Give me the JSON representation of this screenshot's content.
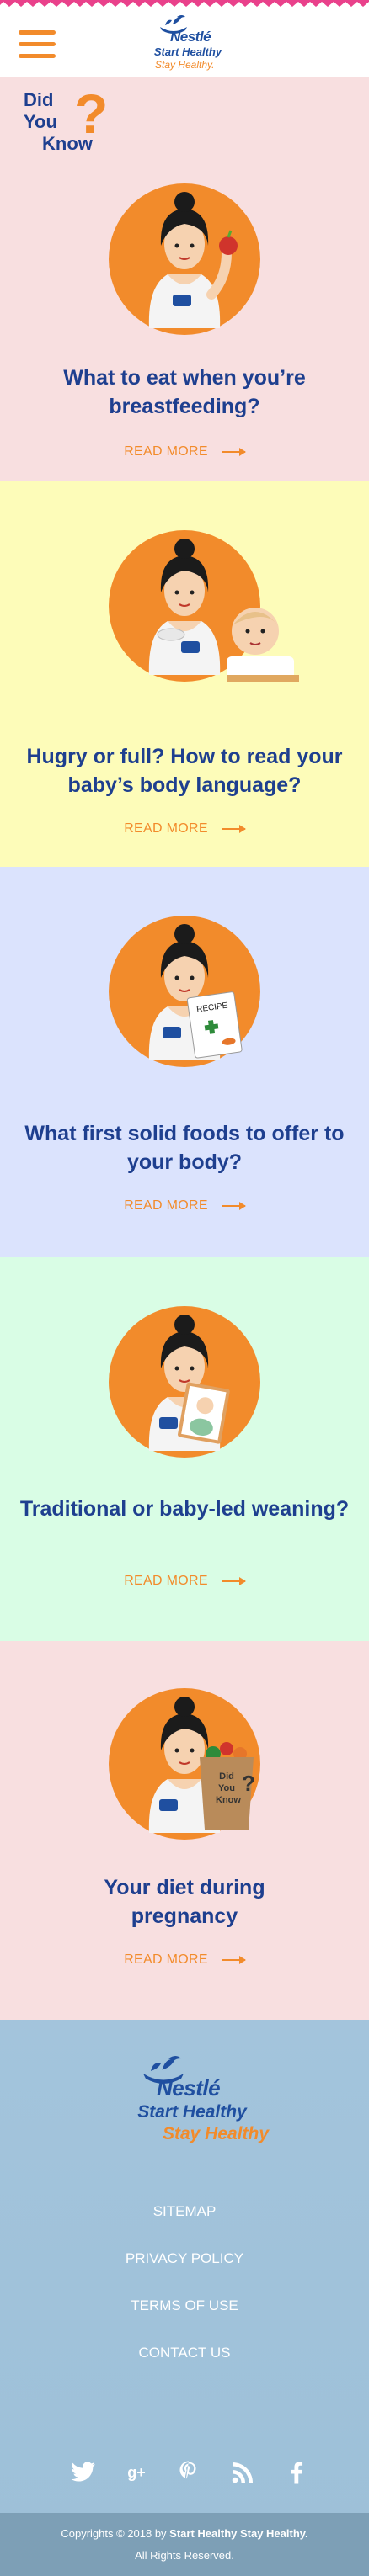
{
  "header": {
    "brand": "Nestlé",
    "tagline_line1": "Start Healthy",
    "tagline_line2": "Stay Healthy."
  },
  "did_you_know": {
    "word1": "Did",
    "word2": "You",
    "word3": "Know",
    "mark": "?"
  },
  "cards": [
    {
      "title": "What to eat when you’re breastfeeding?",
      "cta": "READ MORE",
      "bg": "#f8dfe0"
    },
    {
      "title": "Hugry or full? How to read your baby’s body language?",
      "cta": "READ MORE",
      "bg": "#fdfcb9"
    },
    {
      "title": "What first solid foods to offer to your body?",
      "cta": "READ MORE",
      "bg": "#dbe3fd",
      "recipe_label": "RECIPE"
    },
    {
      "title": "Traditional or baby-led weaning?",
      "cta": "READ MORE",
      "bg": "#d9fde5"
    },
    {
      "title": "Your diet during pregnancy",
      "cta": "READ MORE",
      "bg": "#f8dfe0",
      "bag_words": [
        "Did",
        "You",
        "Know"
      ]
    }
  ],
  "footer": {
    "brand": "Nestlé",
    "tagline_line1": "Start Healthy",
    "tagline_line2": "Stay Healthy",
    "nav": [
      "SITEMAP",
      "PRIVACY POLICY",
      "TERMS OF USE",
      "CONTACT US"
    ],
    "socials": [
      "twitter-icon",
      "google-plus-icon",
      "pinterest-icon",
      "rss-icon",
      "facebook-icon"
    ],
    "copyright_prefix": "Copyrights © 2018 by ",
    "copyright_brand": "Start Healthy Stay Healthy.",
    "rights": "All Rights Reserved."
  },
  "colors": {
    "accent": "#f28b2b",
    "brand_blue": "#1e3f8f",
    "footer_bg": "#a3c4dc",
    "copyright_bg": "#7d9fb6"
  }
}
